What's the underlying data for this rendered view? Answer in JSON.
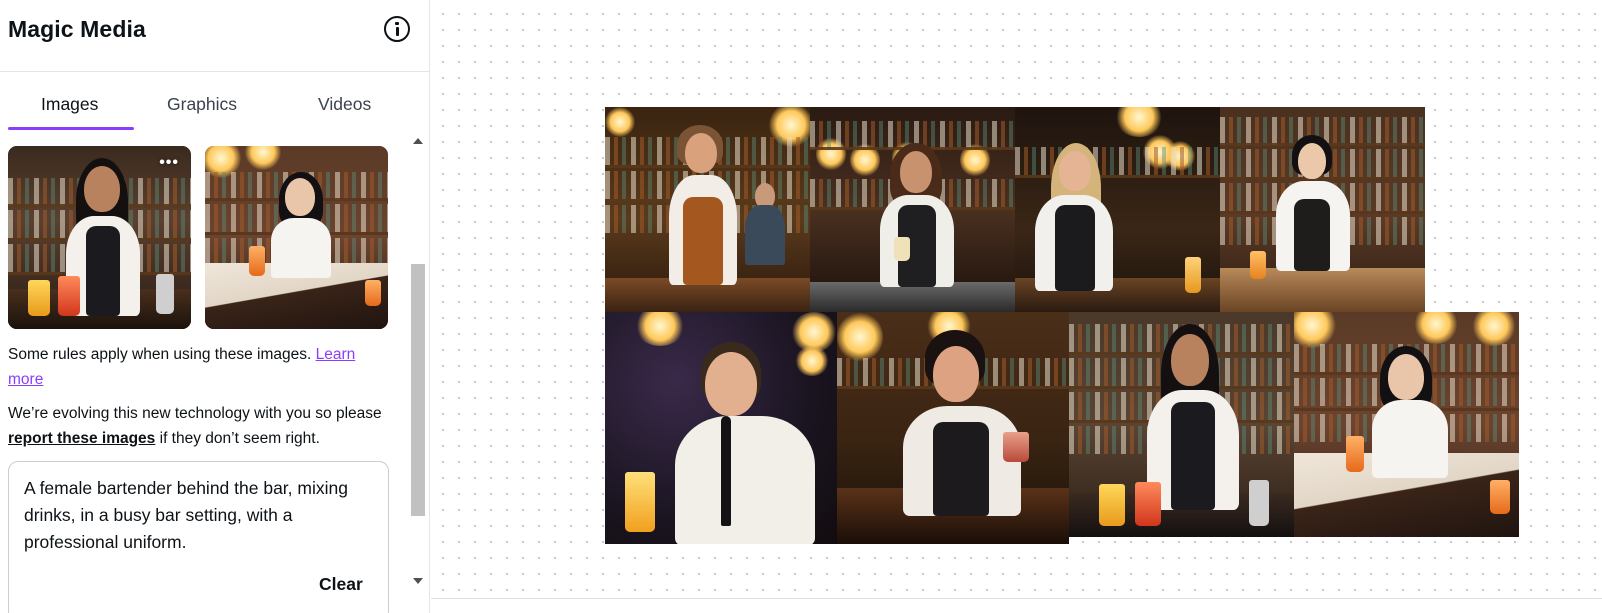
{
  "panel": {
    "title": "Magic Media",
    "tabs": [
      {
        "label": "Images",
        "active": true
      },
      {
        "label": "Graphics",
        "active": false
      },
      {
        "label": "Videos",
        "active": false
      }
    ]
  },
  "notice": {
    "rules_text": "Some rules apply when using these images.",
    "learn_more": "Learn more",
    "evolving_pre": "We’re evolving this new technology with you so please",
    "report_link": "report these images",
    "evolving_post": "if they don’t seem right."
  },
  "prompt": {
    "text": "A female bartender behind the bar, mixing drinks, in a busy bar setting, with a professional uniform.",
    "clear_label": "Clear"
  },
  "thumbnails": [
    {
      "more_label": "•••"
    },
    {
      "more_label": ""
    }
  ],
  "canvas": {
    "image_count": 8
  },
  "colors": {
    "accent": "#8b3dff",
    "text": "#0d1216",
    "border": "#e3e5e8"
  }
}
